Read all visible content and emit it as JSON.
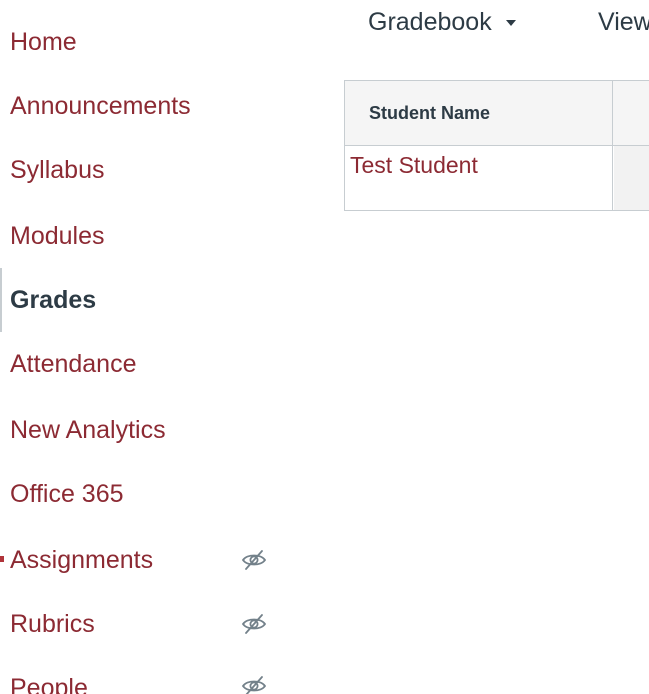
{
  "sidebar": {
    "items": [
      {
        "label": "Home",
        "active": false,
        "hidden": false
      },
      {
        "label": "Announcements",
        "active": false,
        "hidden": false
      },
      {
        "label": "Syllabus",
        "active": false,
        "hidden": false
      },
      {
        "label": "Modules",
        "active": false,
        "hidden": false
      },
      {
        "label": "Grades",
        "active": true,
        "hidden": false
      },
      {
        "label": "Attendance",
        "active": false,
        "hidden": false
      },
      {
        "label": "New Analytics",
        "active": false,
        "hidden": false
      },
      {
        "label": "Office 365",
        "active": false,
        "hidden": false
      },
      {
        "label": "Assignments",
        "active": false,
        "hidden": true,
        "icon": "eye-slash-icon"
      },
      {
        "label": "Rubrics",
        "active": false,
        "hidden": true,
        "icon": "eye-slash-icon"
      },
      {
        "label": "People",
        "active": false,
        "hidden": true,
        "icon": "eye-slash-icon"
      }
    ]
  },
  "topbar": {
    "gradebook_label": "Gradebook",
    "view_label": "View"
  },
  "grid": {
    "columns": [
      "Student Name"
    ],
    "rows": [
      {
        "student_name": "Test Student"
      }
    ]
  },
  "colors": {
    "link": "#8c2a33",
    "text": "#2d3b45",
    "border": "#c7cdd1",
    "header_bg": "#f5f5f5"
  }
}
